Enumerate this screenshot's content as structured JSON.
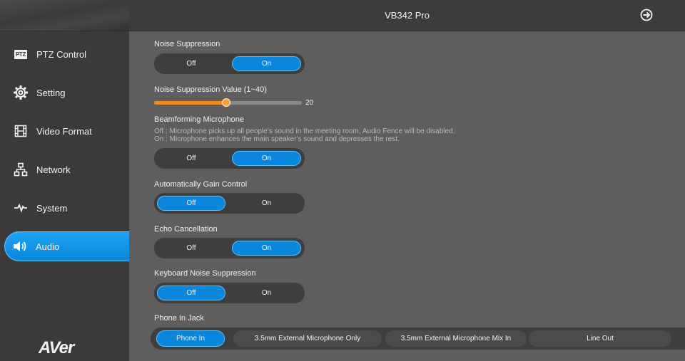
{
  "header": {
    "title": "VB342 Pro",
    "logout_icon": "logout-icon"
  },
  "sidebar": {
    "items": [
      {
        "label": "PTZ Control",
        "icon": "ptz-icon",
        "badge": "PTZ"
      },
      {
        "label": "Setting",
        "icon": "gear-icon"
      },
      {
        "label": "Video Format",
        "icon": "film-icon"
      },
      {
        "label": "Network",
        "icon": "network-icon"
      },
      {
        "label": "System",
        "icon": "pulse-icon"
      },
      {
        "label": "Audio",
        "icon": "speaker-icon",
        "active": true
      }
    ],
    "logo": "AVer"
  },
  "settings": {
    "noise_suppression": {
      "label": "Noise Suppression",
      "off": "Off",
      "on": "On",
      "selected": "On"
    },
    "noise_value": {
      "label": "Noise Suppression Value (1~40)",
      "value": "20",
      "min": 1,
      "max": 40
    },
    "beamforming": {
      "label": "Beamforming Microphone",
      "desc_off": "Off : Microphone picks up all people's sound in the meeting room, Audio Fence will be disabled.",
      "desc_on": "On : Microphone enhances the main speaker's sound and depresses the rest.",
      "off": "Off",
      "on": "On",
      "selected": "On"
    },
    "agc": {
      "label": "Automatically Gain Control",
      "off": "Off",
      "on": "On",
      "selected": "Off"
    },
    "echo": {
      "label": "Echo Cancellation",
      "off": "Off",
      "on": "On",
      "selected": "On"
    },
    "keyboard": {
      "label": "Keyboard Noise Suppression",
      "off": "Off",
      "on": "On",
      "selected": "Off"
    },
    "phone_jack": {
      "label": "Phone In Jack",
      "options": [
        "Phone In",
        "3.5mm External Microphone Only",
        "3.5mm External Microphone Mix In",
        "Line Out"
      ],
      "selected": "Phone In"
    }
  },
  "colors": {
    "accent": "#0a87dd",
    "slider": "#f18a1c",
    "background": "#5e5e5e",
    "sidebar": "#3a3a3a"
  }
}
